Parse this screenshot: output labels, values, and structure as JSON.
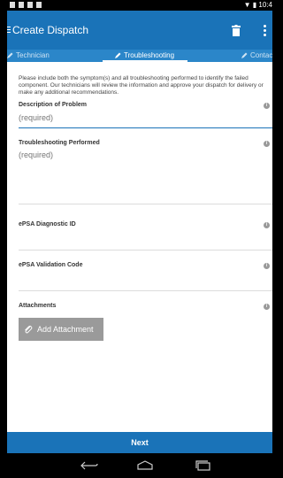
{
  "status_bar": {
    "time": "10:4"
  },
  "app_bar": {
    "title": "Create Dispatch"
  },
  "tabs": [
    {
      "label": "Technician"
    },
    {
      "label": "Troubleshooting"
    },
    {
      "label": "Contac"
    }
  ],
  "intro_text": "Please include both the symptom(s) and all troubleshooting performed to identify the failed component. Our technicians will review the information and approve your dispatch for delivery or make any additional recommendations.",
  "fields": {
    "description": {
      "label": "Description of Problem",
      "placeholder": "(required)"
    },
    "troubleshooting": {
      "label": "Troubleshooting Performed",
      "placeholder": "(required)"
    },
    "epsa_id": {
      "label": "ePSA Diagnostic ID",
      "placeholder": ""
    },
    "epsa_code": {
      "label": "ePSA Validation Code",
      "placeholder": ""
    }
  },
  "attachments": {
    "label": "Attachments",
    "button_label": "Add Attachment"
  },
  "footer": {
    "next_label": "Next"
  },
  "colors": {
    "primary": "#1a73b8",
    "tab_bar": "#2b86c9",
    "button_gray": "#9a9a9a"
  }
}
